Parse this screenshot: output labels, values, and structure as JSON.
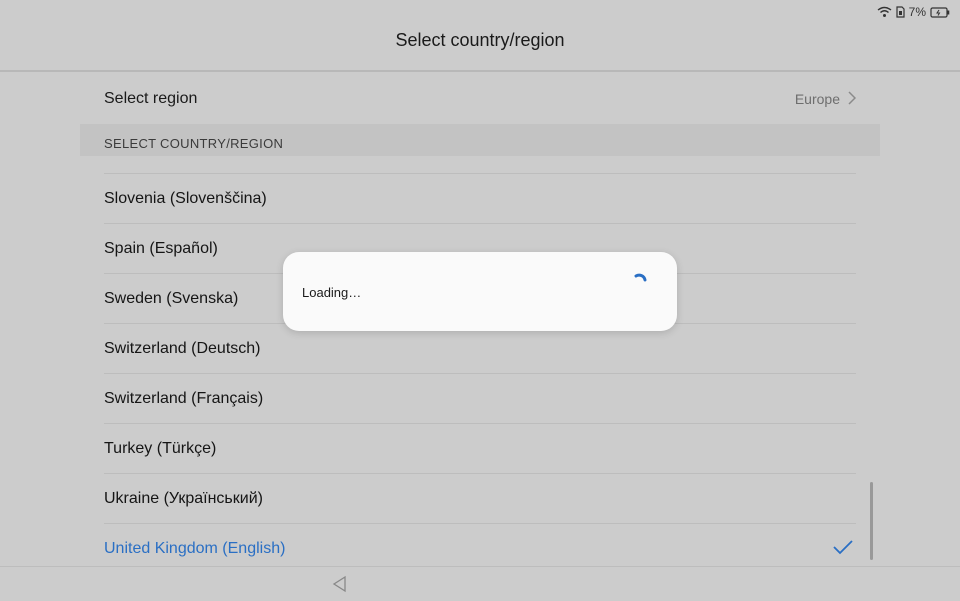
{
  "status_bar": {
    "battery_percent": "7%",
    "icons": [
      "wifi-icon",
      "sim-icon",
      "battery-icon"
    ]
  },
  "header": {
    "title": "Select country/region"
  },
  "region": {
    "label": "Select region",
    "value": "Europe"
  },
  "section": {
    "header": "SELECT COUNTRY/REGION"
  },
  "list": {
    "items": [
      {
        "label": "Slovenia (Slovenščina)"
      },
      {
        "label": "Spain (Español)"
      },
      {
        "label": "Sweden (Svenska)"
      },
      {
        "label": "Switzerland (Deutsch)"
      },
      {
        "label": "Switzerland (Français)"
      },
      {
        "label": "Turkey (Türkçe)"
      },
      {
        "label": "Ukraine (Український)"
      },
      {
        "label": "United Kingdom (English)",
        "selected": true
      }
    ]
  },
  "dialog": {
    "text": "Loading…"
  },
  "colors": {
    "accent": "#2a6fc4",
    "background": "#cccccc",
    "dialog": "#fafafa"
  }
}
